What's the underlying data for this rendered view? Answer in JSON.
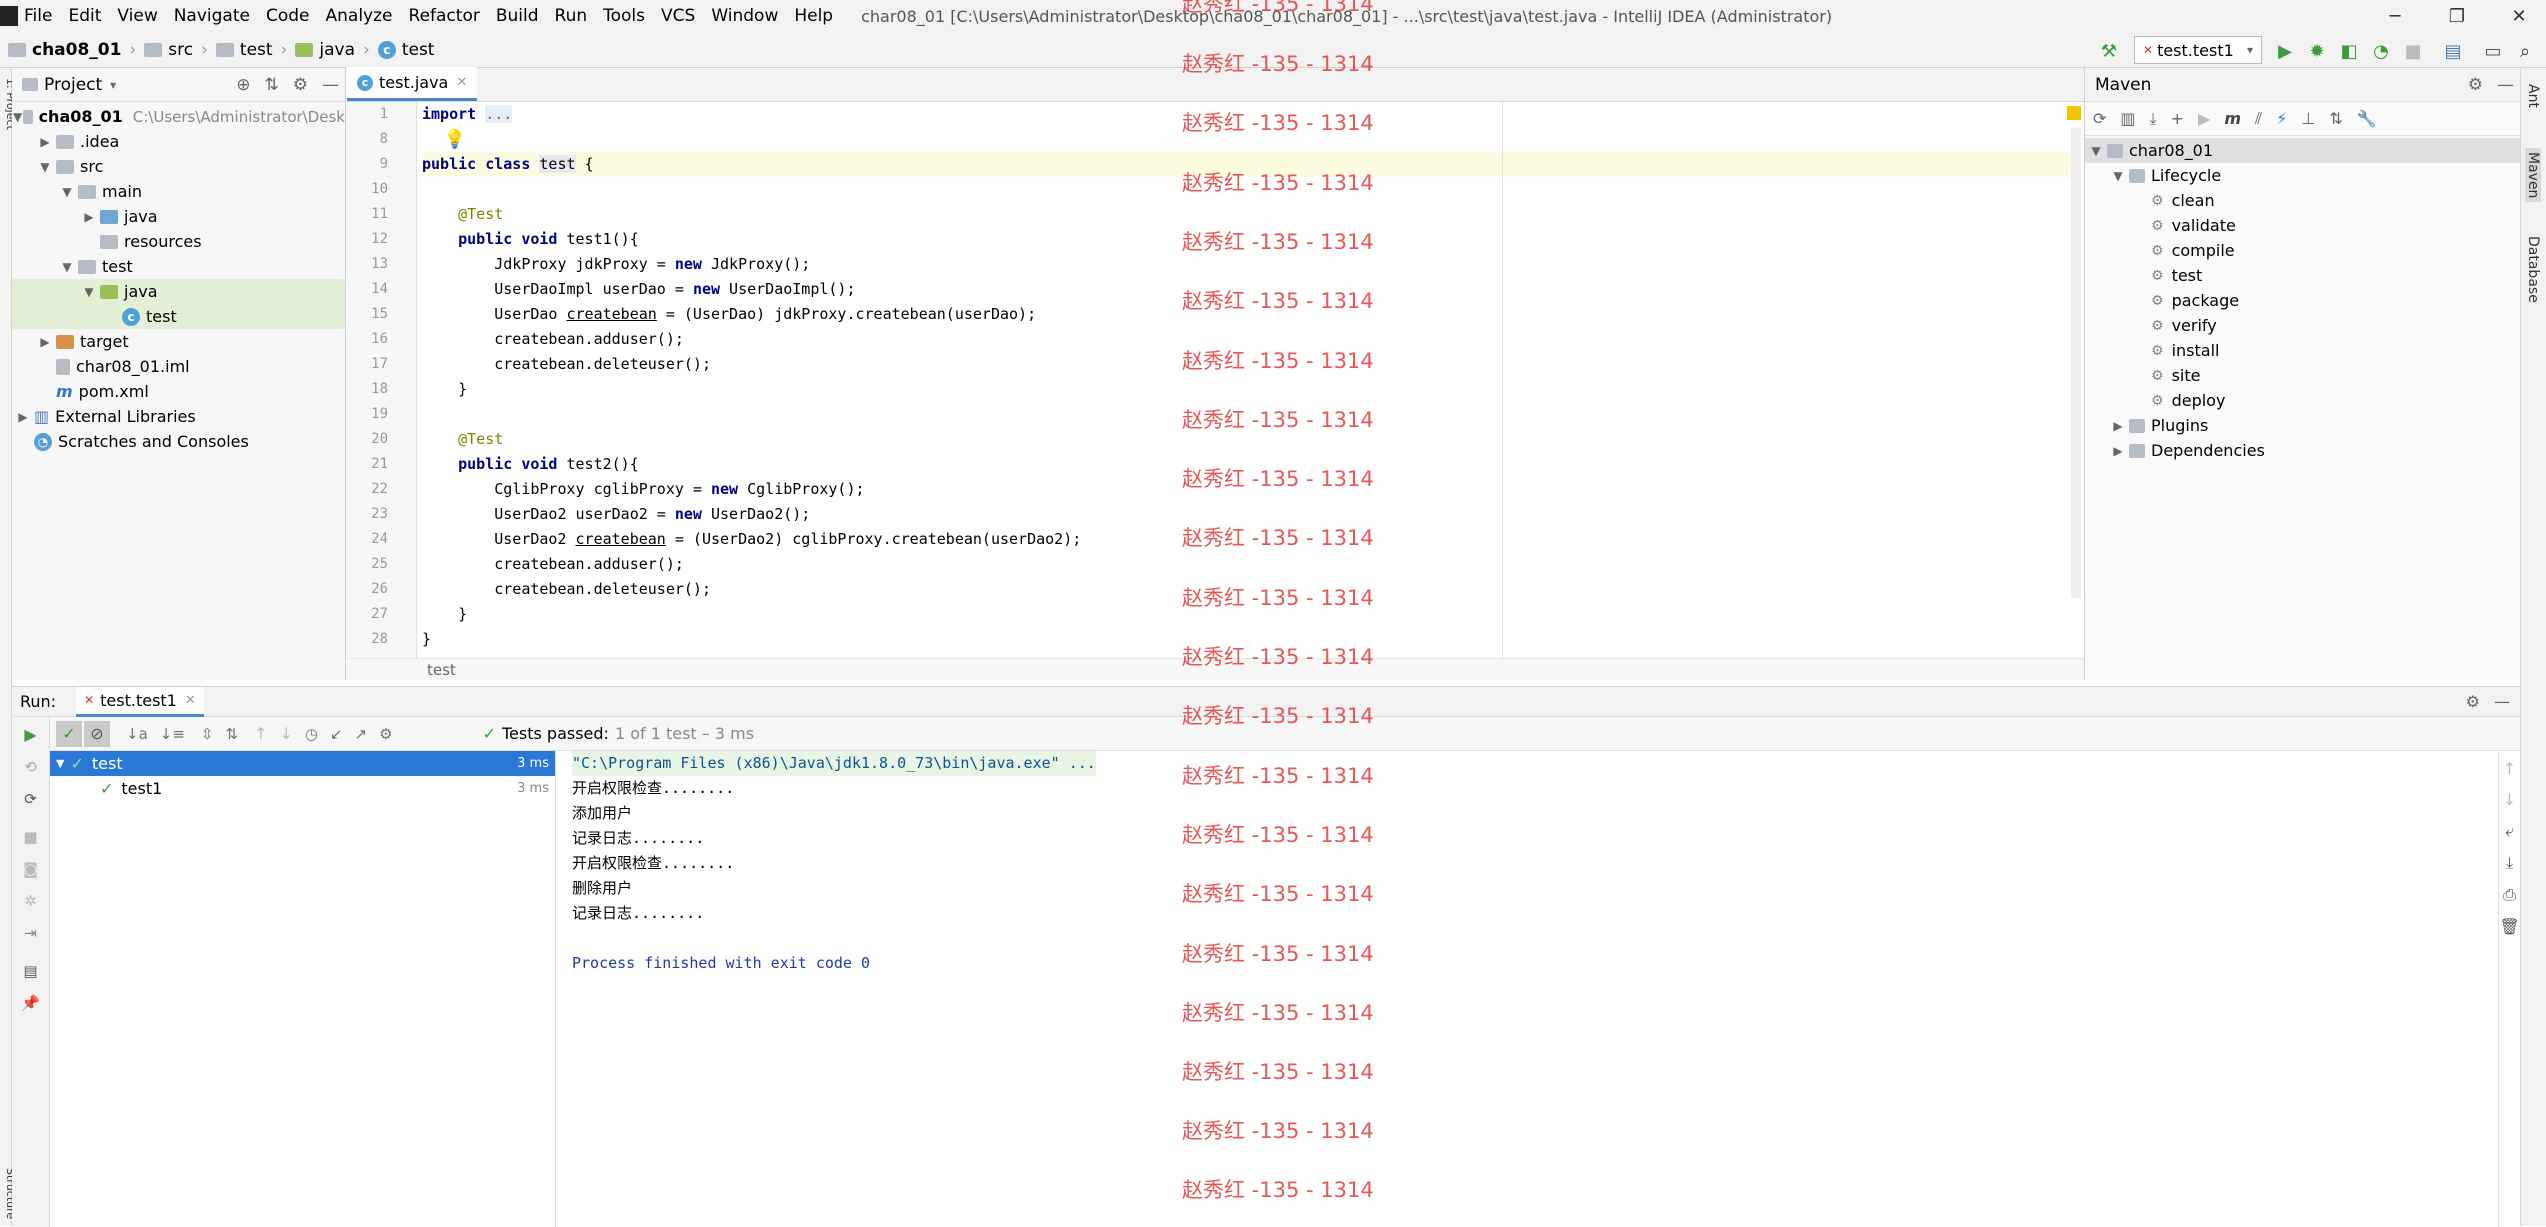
{
  "menu": {
    "items": [
      "File",
      "Edit",
      "View",
      "Navigate",
      "Code",
      "Analyze",
      "Refactor",
      "Build",
      "Run",
      "Tools",
      "VCS",
      "Window",
      "Help"
    ],
    "window_title": "char08_01 [C:\\Users\\Administrator\\Desktop\\cha08_01\\char08_01] - ...\\src\\test\\java\\test.java - IntelliJ IDEA (Administrator)"
  },
  "breadcrumb": [
    "cha08_01",
    "src",
    "test",
    "java",
    "test"
  ],
  "run_config": "test.test1",
  "project": {
    "header": "Project",
    "tree": [
      {
        "label": "cha08_01",
        "path": "C:\\Users\\Administrator\\Desk",
        "indent": 0,
        "arrow": "down",
        "icon": "plain"
      },
      {
        "label": ".idea",
        "indent": 1,
        "arrow": "right",
        "icon": "plain"
      },
      {
        "label": "src",
        "indent": 1,
        "arrow": "down",
        "icon": "plain"
      },
      {
        "label": "main",
        "indent": 2,
        "arrow": "down",
        "icon": "plain"
      },
      {
        "label": "java",
        "indent": 3,
        "arrow": "right",
        "icon": "blue"
      },
      {
        "label": "resources",
        "indent": 3,
        "arrow": "",
        "icon": "plain"
      },
      {
        "label": "test",
        "indent": 2,
        "arrow": "down",
        "icon": "plain"
      },
      {
        "label": "java",
        "indent": 3,
        "arrow": "down",
        "icon": "green",
        "sel": true
      },
      {
        "label": "test",
        "indent": 4,
        "arrow": "",
        "icon": "class",
        "sel": true
      },
      {
        "label": "target",
        "indent": 1,
        "arrow": "right",
        "icon": "orange"
      },
      {
        "label": "char08_01.iml",
        "indent": 1,
        "arrow": "",
        "icon": "file"
      },
      {
        "label": "pom.xml",
        "indent": 1,
        "arrow": "",
        "icon": "maven"
      },
      {
        "label": "External Libraries",
        "indent": 0,
        "arrow": "right",
        "icon": "lib"
      },
      {
        "label": "Scratches and Consoles",
        "indent": 0,
        "arrow": "",
        "icon": "scratch"
      }
    ]
  },
  "editor": {
    "tab": "test.java",
    "line_numbers": [
      "1",
      "8",
      "9",
      "10",
      "11",
      "12",
      "13",
      "14",
      "15",
      "16",
      "17",
      "18",
      "19",
      "20",
      "21",
      "22",
      "23",
      "24",
      "25",
      "26",
      "27",
      "28"
    ],
    "breadcrumb": "test"
  },
  "maven": {
    "header": "Maven",
    "root": "char08_01",
    "lifecycle_label": "Lifecycle",
    "lifecycle": [
      "clean",
      "validate",
      "compile",
      "test",
      "package",
      "verify",
      "install",
      "site",
      "deploy"
    ],
    "plugins": "Plugins",
    "dependencies": "Dependencies"
  },
  "side_labels": {
    "ant": "Ant",
    "maven": "Maven",
    "database": "Database",
    "structure": "Z: Structure"
  },
  "run": {
    "label": "Run:",
    "tab": "test.test1",
    "status_bold": "Tests passed:",
    "status_rest": "1 of 1 test – 3 ms",
    "tree": [
      {
        "label": "test",
        "time": "3 ms",
        "sel": true
      },
      {
        "label": "test1",
        "time": "3 ms",
        "sel": false
      }
    ],
    "console": [
      "\"C:\\Program Files (x86)\\Java\\jdk1.8.0_73\\bin\\java.exe\" ...",
      "开启权限检查........",
      "添加用户",
      "记录日志........",
      "开启权限检查........",
      "删除用户",
      "记录日志........",
      "",
      "Process finished with exit code 0"
    ]
  },
  "watermark": "赵秀红 -135 - 1314"
}
